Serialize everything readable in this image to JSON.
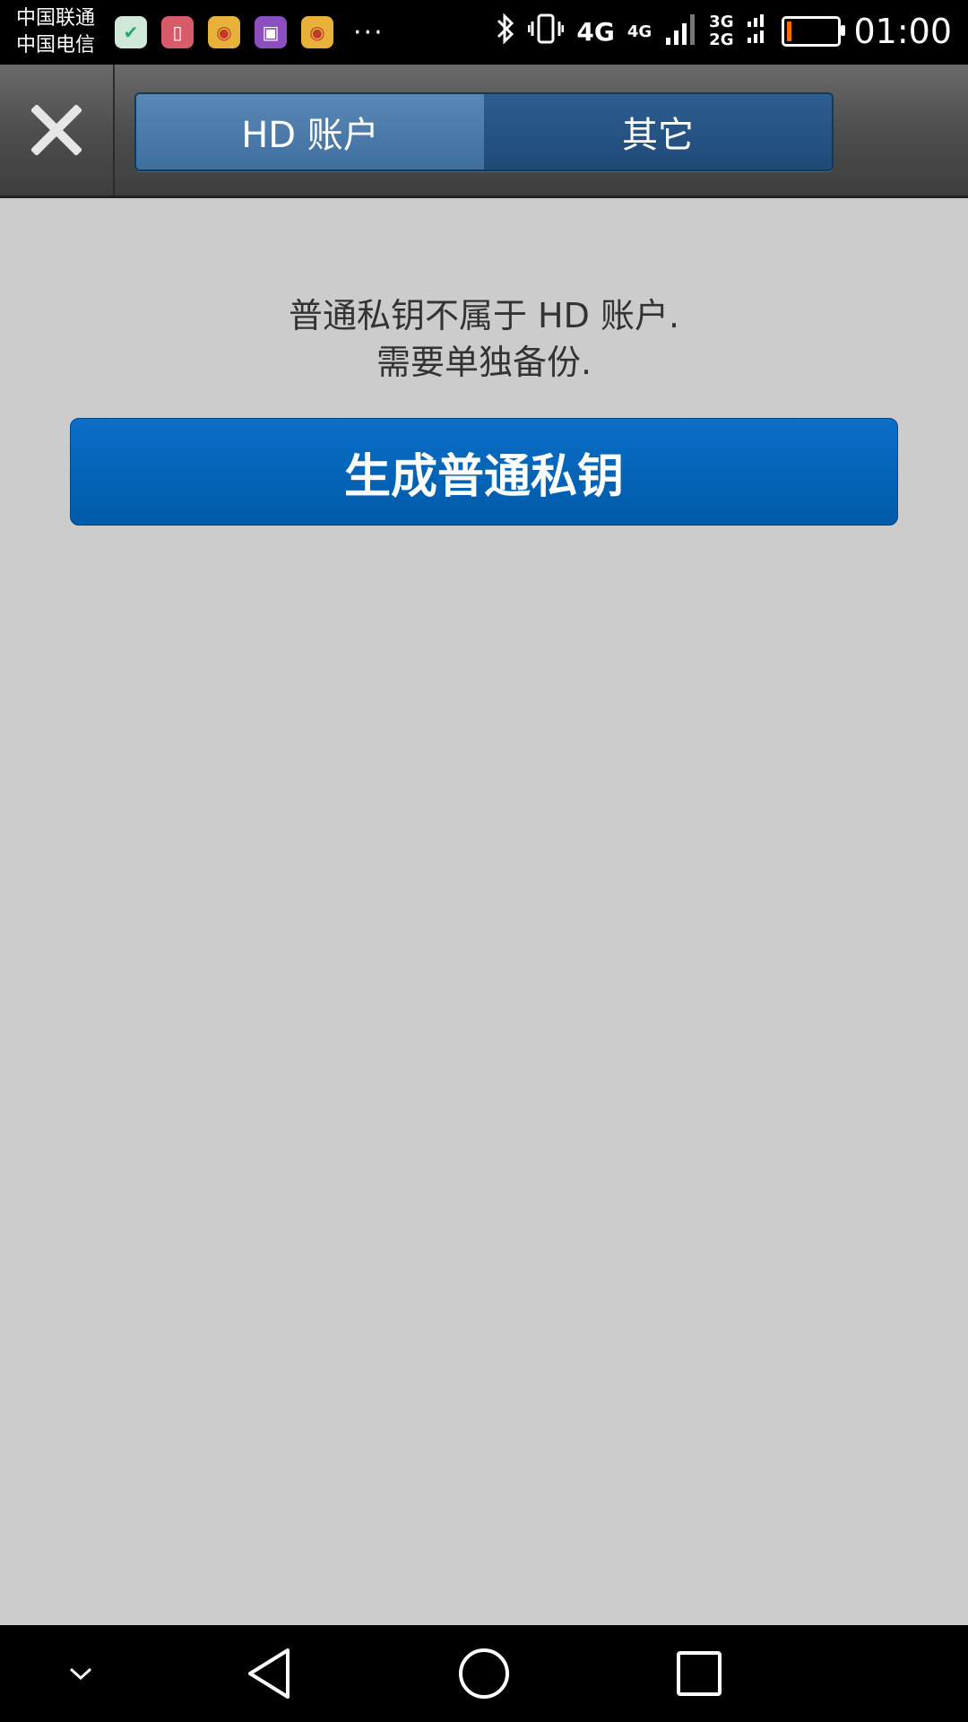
{
  "status_bar": {
    "carrier_1": "中国联通",
    "carrier_2": "中国电信",
    "network_1": "4G",
    "network_2": "4G",
    "network_3": "3G",
    "network_4": "2G",
    "time": "01:00",
    "more": "···"
  },
  "header": {
    "tabs": [
      {
        "label": "HD 账户"
      },
      {
        "label": "其它"
      }
    ]
  },
  "content": {
    "message_line_1": "普通私钥不属于 HD 账户.",
    "message_line_2": "需要单独备份.",
    "generate_button_label": "生成普通私钥"
  },
  "colors": {
    "primary_button": "#0a6fc8",
    "active_tab": "#5a88b6",
    "inactive_tab": "#2d5e91",
    "background": "#cccccc"
  }
}
